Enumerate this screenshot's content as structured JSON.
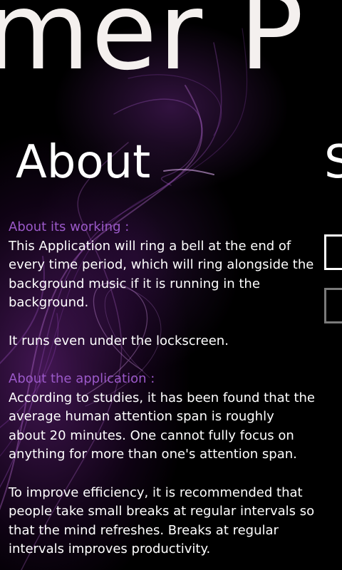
{
  "panorama": {
    "title": "mer P"
  },
  "about": {
    "header": "About",
    "working_heading": "About its working :",
    "working_text": "This Application will ring a bell at the end of every time period, which will ring alongside the background music if it is running in the background.",
    "lockscreen_text": "It runs even under the lockscreen.",
    "application_heading": "About the application :",
    "application_text": "According to studies, it has been found that the average human attention span is roughly about 20 minutes. One cannot fully focus on anything for more than one's attention span.",
    "efficiency_text": "To improve efficiency, it is recommended that people take small breaks at regular intervals so that the mind refreshes. Breaks at regular intervals improves productivity."
  },
  "next_section": {
    "header_partial": "S"
  },
  "colors": {
    "accent": "#9b59c9",
    "background": "#000000",
    "text": "#ffffff"
  }
}
